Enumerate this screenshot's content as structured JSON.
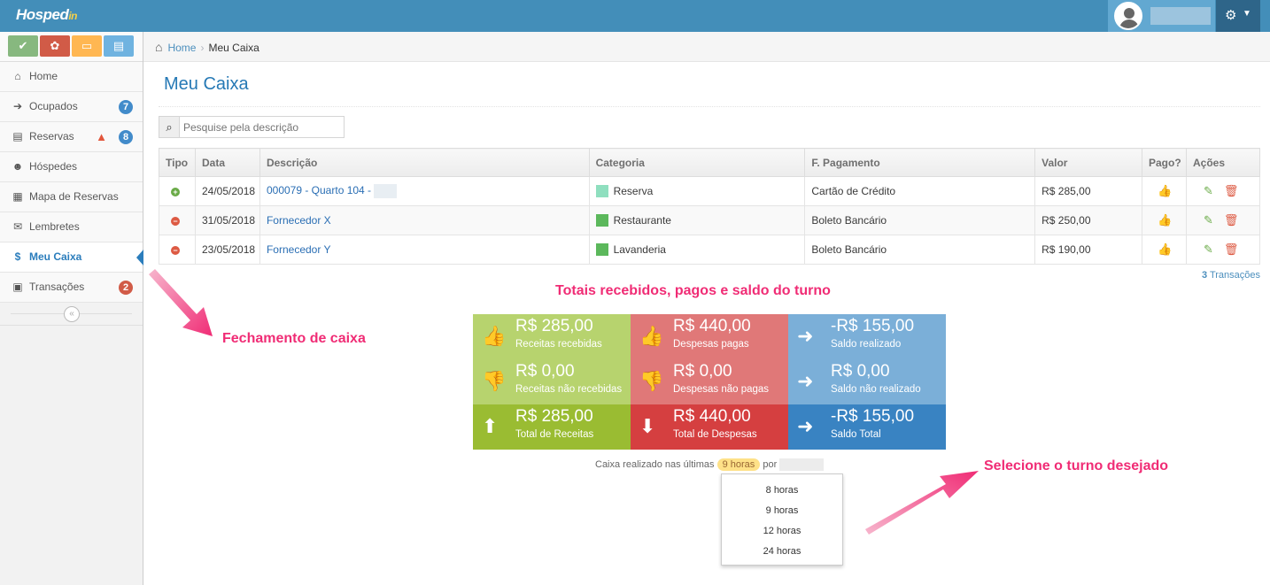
{
  "header": {
    "logo": "Hosped",
    "logo_suffix": "in",
    "user_name": ""
  },
  "shortcuts": [
    {
      "icon": "check-icon",
      "glyph": "✔",
      "color": "#87b87f"
    },
    {
      "icon": "lifebuoy-icon",
      "glyph": "✿",
      "color": "#d15b47"
    },
    {
      "icon": "inbox-icon",
      "glyph": "▭",
      "color": "#ffb752"
    },
    {
      "icon": "book-icon",
      "glyph": "▤",
      "color": "#6fb3e0"
    }
  ],
  "sidebar": {
    "items": [
      {
        "label": "Home",
        "glyph": "⌂",
        "badge": ""
      },
      {
        "label": "Ocupados",
        "glyph": "➔",
        "badge": "7"
      },
      {
        "label": "Reservas",
        "glyph": "▤",
        "badge": "8"
      },
      {
        "label": "Hóspedes",
        "glyph": "☻",
        "badge": ""
      },
      {
        "label": "Mapa de Reservas",
        "glyph": "▦",
        "badge": ""
      },
      {
        "label": "Lembretes",
        "glyph": "✉",
        "badge": ""
      },
      {
        "label": "Meu Caixa",
        "glyph": "$",
        "badge": ""
      },
      {
        "label": "Transações",
        "glyph": "▣",
        "badge": "2"
      }
    ],
    "badge_colors": {
      "blue": "#428bca",
      "red": "#d15b47"
    },
    "collapse_glyph": "«"
  },
  "breadcrumb": {
    "home": "Home",
    "current": "Meu Caixa"
  },
  "page": {
    "title": "Meu Caixa"
  },
  "search": {
    "placeholder": "Pesquise pela descrição"
  },
  "table": {
    "headers": [
      "Tipo",
      "Data",
      "Descrição",
      "Categoria",
      "F. Pagamento",
      "Valor",
      "Pago?",
      "Ações"
    ],
    "rows": [
      {
        "type": "+",
        "date": "24/05/2018",
        "desc": "000079 - Quarto 104 -",
        "category": "Reserva",
        "cat_color": "#8fdfbf",
        "payment": "Cartão de Crédito",
        "value": "R$ 285,00"
      },
      {
        "type": "−",
        "date": "31/05/2018",
        "desc": "Fornecedor X",
        "category": "Restaurante",
        "cat_color": "#5cb85c",
        "payment": "Boleto Bancário",
        "value": "R$ 250,00"
      },
      {
        "type": "−",
        "date": "23/05/2018",
        "desc": "Fornecedor Y",
        "category": "Lavanderia",
        "cat_color": "#5cb85c",
        "payment": "Boleto Bancário",
        "value": "R$ 190,00"
      }
    ],
    "count_num": "3",
    "count_label": "Transações"
  },
  "annotations": {
    "totais": "Totais recebidos, pagos e saldo do turno",
    "fechamento": "Fechamento de caixa",
    "selecione": "Selecione o turno desejado"
  },
  "tiles": [
    {
      "value": "R$ 285,00",
      "label": "Receitas recebidas",
      "icon": "thumbs-up-icon",
      "glyph": "👍",
      "color": "#b7d36e"
    },
    {
      "value": "R$ 440,00",
      "label": "Despesas pagas",
      "icon": "thumbs-up-icon",
      "glyph": "👍",
      "color": "#e07878"
    },
    {
      "value": "-R$ 155,00",
      "label": "Saldo realizado",
      "icon": "arrow-right-icon",
      "glyph": "➜",
      "color": "#7bafd8"
    },
    {
      "value": "R$ 0,00",
      "label": "Receitas não recebidas",
      "icon": "thumbs-down-icon",
      "glyph": "👎",
      "color": "#b7d36e"
    },
    {
      "value": "R$ 0,00",
      "label": "Despesas não pagas",
      "icon": "thumbs-down-icon",
      "glyph": "👎",
      "color": "#e07878"
    },
    {
      "value": "R$ 0,00",
      "label": "Saldo não realizado",
      "icon": "arrow-right-icon",
      "glyph": "➜",
      "color": "#7bafd8"
    },
    {
      "value": "R$ 285,00",
      "label": "Total de Receitas",
      "icon": "arrow-up-icon",
      "glyph": "⬆",
      "color": "#9abc32"
    },
    {
      "value": "R$ 440,00",
      "label": "Total de Despesas",
      "icon": "arrow-down-icon",
      "glyph": "⬇",
      "color": "#d53f40"
    },
    {
      "value": "-R$ 155,00",
      "label": "Saldo Total",
      "icon": "arrow-right-icon",
      "glyph": "➜",
      "color": "#3983c2"
    }
  ],
  "caixa": {
    "prefix": "Caixa realizado nas últimas",
    "hours": "9 horas",
    "by": "por"
  },
  "hours_options": [
    "8 horas",
    "9 horas",
    "12 horas",
    "24 horas"
  ]
}
